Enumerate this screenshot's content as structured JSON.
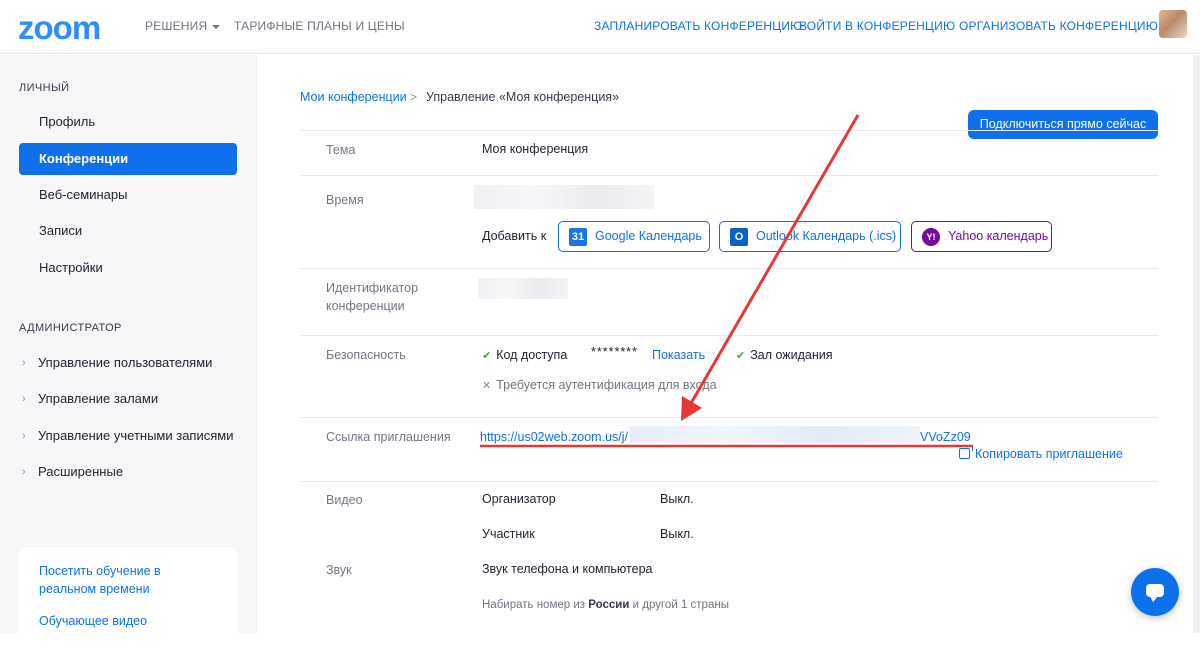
{
  "header": {
    "logo": "zoom",
    "nav_left": [
      "РЕШЕНИЯ",
      "ТАРИФНЫЕ ПЛАНЫ И ЦЕНЫ"
    ],
    "nav_right": [
      "ЗАПЛАНИРОВАТЬ КОНФЕРЕНЦИЮ",
      "ВОЙТИ В КОНФЕРЕНЦИЮ",
      "ОРГАНИЗОВАТЬ КОНФЕРЕНЦИЮ"
    ]
  },
  "sidebar": {
    "personal_title": "ЛИЧНЫЙ",
    "personal_items": [
      "Профиль",
      "Конференции",
      "Веб-семинары",
      "Записи",
      "Настройки"
    ],
    "admin_title": "АДМИНИСТРАТОР",
    "admin_items": [
      "Управление пользователями",
      "Управление залами",
      "Управление учетными записями",
      "Расширенные"
    ],
    "card_links": [
      "Посетить обучение в реальном времени",
      "Обучающее видео"
    ]
  },
  "main": {
    "breadcrumb": {
      "link": "Мои конференции",
      "separator": ">",
      "current": "Управление «Моя конференция»"
    },
    "join_button": "Подключиться прямо сейчас",
    "topic": {
      "label": "Тема",
      "value": "Моя конференция"
    },
    "time": {
      "label": "Время",
      "add_to": "Добавить к",
      "google": "Google Календарь",
      "google_icon": "31",
      "outlook": "Outlook Календарь (.ics)",
      "outlook_icon": "O",
      "yahoo": "Yahoo календарь",
      "yahoo_icon": "Y!"
    },
    "meeting_id": {
      "label": "Идентификатор конференции"
    },
    "security": {
      "label": "Безопасность",
      "passcode": "Код доступа",
      "passcode_mask": "********",
      "show": "Показать",
      "waiting_room": "Зал ожидания",
      "auth_required": "Требуется аутентификация для входа"
    },
    "invite": {
      "label": "Ссылка приглашения",
      "url_start": "https://us02web.zoom.us/j/",
      "url_end": "VVoZz09",
      "copy": "Копировать приглашение"
    },
    "video": {
      "label": "Видео",
      "host": "Организатор",
      "host_value": "Выкл.",
      "participant": "Участник",
      "participant_value": "Выкл."
    },
    "audio": {
      "label": "Звук",
      "value": "Звук телефона и компьютера",
      "dial_prefix": "Набирать номер из ",
      "dial_country": "России",
      "dial_suffix": " и другой 1 страны"
    }
  },
  "colors": {
    "accent": "#0e71eb",
    "annotation_red": "#e53935",
    "yahoo": "#720e9e"
  }
}
